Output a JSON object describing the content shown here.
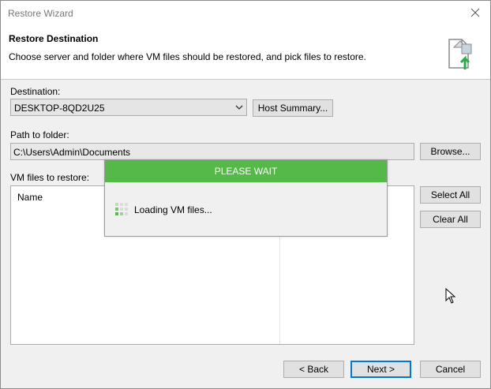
{
  "window": {
    "title": "Restore Wizard"
  },
  "header": {
    "title": "Restore Destination",
    "description": "Choose server and folder where VM files should be restored, and pick files to restore."
  },
  "destination": {
    "label": "Destination:",
    "selected": "DESKTOP-8QD2U25",
    "host_summary_label": "Host Summary..."
  },
  "path": {
    "label": "Path to folder:",
    "value": "C:\\Users\\Admin\\Documents",
    "browse_label": "Browse..."
  },
  "files": {
    "label": "VM files to restore:",
    "column_name": "Name",
    "select_all_label": "Select All",
    "clear_all_label": "Clear All"
  },
  "overlay": {
    "title": "PLEASE WAIT",
    "message": "Loading VM files...",
    "accent_color": "#54b948"
  },
  "footer": {
    "back_label": "< Back",
    "next_label": "Next >",
    "cancel_label": "Cancel"
  },
  "icons": {
    "close": "close-icon",
    "header": "restore-document-icon",
    "spinner": "loading-spinner-icon",
    "cursor": "mouse-cursor-icon"
  }
}
